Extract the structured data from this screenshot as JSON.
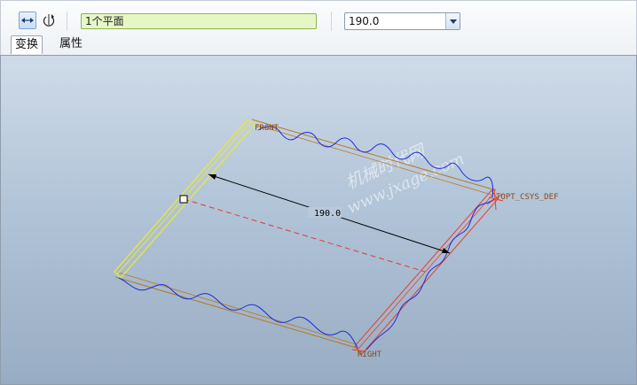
{
  "toolbar": {
    "translate_icon": "translate-arrows-icon",
    "rotate_icon": "rotate-icon",
    "reference_value": "1个平面",
    "offset_value": "190.0",
    "dropdown_icon": "chevron-down-icon"
  },
  "tabs": [
    {
      "label": "变换",
      "selected": true
    },
    {
      "label": "属性",
      "selected": false
    }
  ],
  "model": {
    "front_label": "FRONT",
    "right_label": "RIGHT",
    "csys_label": "TOPT_CSYS_DEF",
    "dimension_value": "190.0",
    "watermark": "机械时代网",
    "watermark_url": "www.jxage.com"
  },
  "colors": {
    "wave": "#1a2dd8",
    "plane_edge": "#b8791f",
    "selected_plane": "#e6e63c",
    "highlight_plane": "#e8402e",
    "dimension": "#000000"
  }
}
